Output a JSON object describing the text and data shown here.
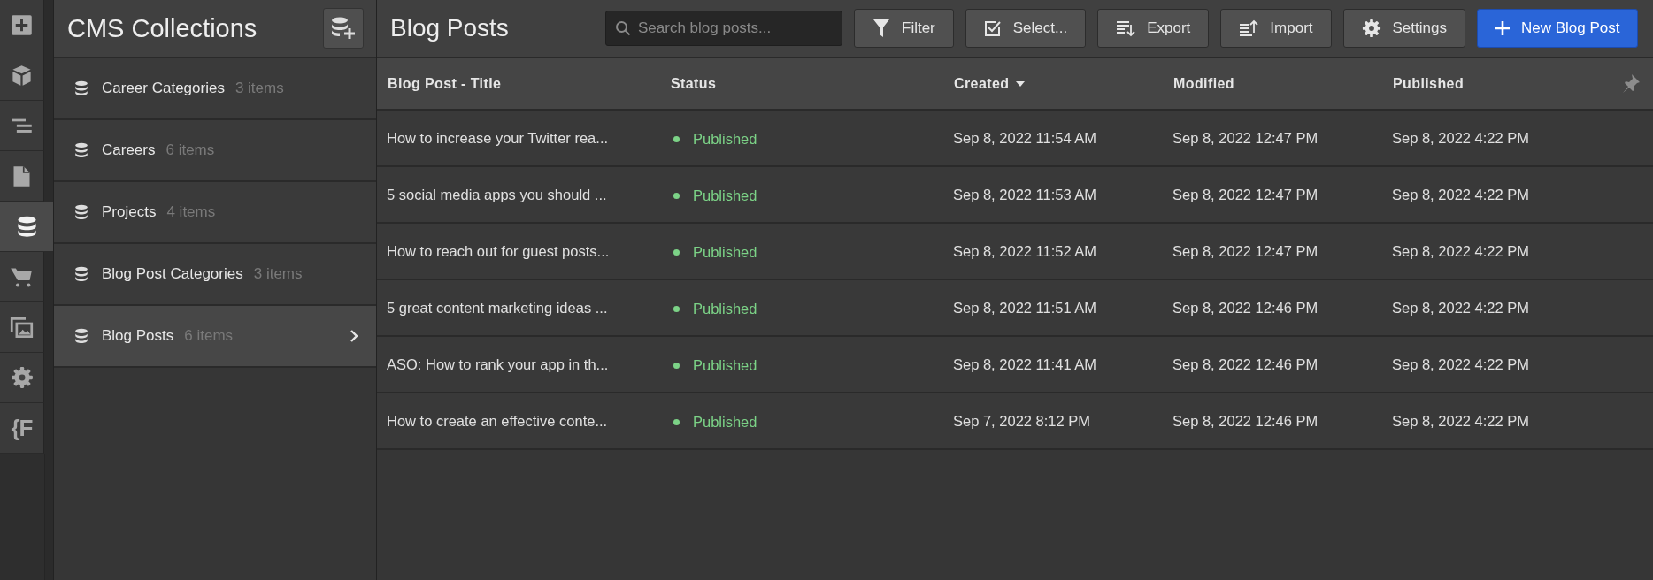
{
  "rail": [
    {
      "selected": false
    },
    {
      "selected": false
    },
    {
      "selected": false
    },
    {
      "selected": false
    },
    {
      "selected": true
    },
    {
      "selected": false
    },
    {
      "selected": false
    },
    {
      "selected": false
    },
    {
      "selected": false,
      "glyph": "{F"
    }
  ],
  "collections": {
    "title": "CMS Collections",
    "items": [
      {
        "name": "Career Categories",
        "count": "3 items",
        "selected": false
      },
      {
        "name": "Careers",
        "count": "6 items",
        "selected": false
      },
      {
        "name": "Projects",
        "count": "4 items",
        "selected": false
      },
      {
        "name": "Blog Post Categories",
        "count": "3 items",
        "selected": false
      },
      {
        "name": "Blog Posts",
        "count": "6 items",
        "selected": true
      }
    ]
  },
  "toolbar": {
    "title": "Blog Posts",
    "search": {
      "placeholder": "Search blog posts..."
    },
    "buttons": [
      {
        "label": "Filter",
        "kind": "filter"
      },
      {
        "label": "Select...",
        "kind": "select"
      },
      {
        "label": "Export",
        "kind": "export"
      },
      {
        "label": "Import",
        "kind": "import"
      },
      {
        "label": "Settings",
        "kind": "settings"
      },
      {
        "label": "New Blog Post",
        "kind": "primary"
      }
    ]
  },
  "table": {
    "columns": [
      {
        "label": "Blog Post - Title",
        "sorted": false
      },
      {
        "label": "Status",
        "sorted": false
      },
      {
        "label": "Created",
        "sorted": true
      },
      {
        "label": "Modified",
        "sorted": false
      },
      {
        "label": "Published",
        "sorted": false
      }
    ],
    "rows": [
      [
        "How to increase your Twitter rea...",
        "Published",
        "Sep 8, 2022 11:54 AM",
        "Sep 8, 2022 12:47 PM",
        "Sep 8, 2022 4:22 PM"
      ],
      [
        "5 social media apps you should ...",
        "Published",
        "Sep 8, 2022 11:53 AM",
        "Sep 8, 2022 12:47 PM",
        "Sep 8, 2022 4:22 PM"
      ],
      [
        "How to reach out for guest posts...",
        "Published",
        "Sep 8, 2022 11:52 AM",
        "Sep 8, 2022 12:47 PM",
        "Sep 8, 2022 4:22 PM"
      ],
      [
        "5 great content marketing ideas ...",
        "Published",
        "Sep 8, 2022 11:51 AM",
        "Sep 8, 2022 12:46 PM",
        "Sep 8, 2022 4:22 PM"
      ],
      [
        "ASO: How to rank your app in th...",
        "Published",
        "Sep 8, 2022 11:41 AM",
        "Sep 8, 2022 12:46 PM",
        "Sep 8, 2022 4:22 PM"
      ],
      [
        "How to create an effective conte...",
        "Published",
        "Sep 7, 2022 8:12 PM",
        "Sep 8, 2022 12:46 PM",
        "Sep 8, 2022 4:22 PM"
      ]
    ]
  }
}
